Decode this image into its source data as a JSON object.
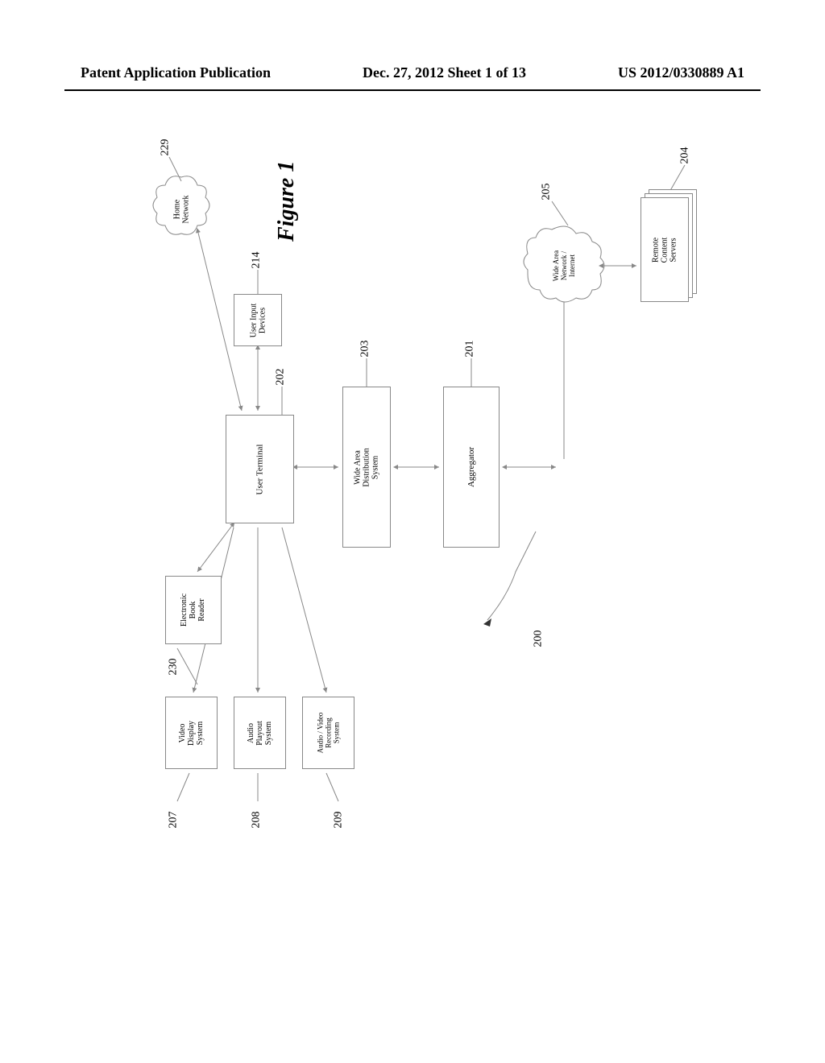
{
  "header": {
    "left": "Patent Application Publication",
    "center": "Dec. 27, 2012  Sheet 1 of 13",
    "right": "US 2012/0330889 A1"
  },
  "figure_title": "Figure 1",
  "boxes": {
    "user_input": "User Input\nDevices",
    "user_terminal": "User Terminal",
    "ebook_reader": "Electronic\nBook\nReader",
    "video_display": "Video\nDisplay\nSystem",
    "audio_playout": "Audio\nPlayout\nSystem",
    "av_recording": "Audio / Video\nRecording\nSystem",
    "wads": "Wide Area\nDistribution System",
    "aggregator": "Aggregator",
    "remote_servers": "Remote\nContent\nServers"
  },
  "clouds": {
    "home_network": "Home\nNetwork",
    "wan": "Wide Area\nNetwork /\nInternet"
  },
  "refs": {
    "r214": "214",
    "r229": "229",
    "r202": "202",
    "r203": "203",
    "r201": "201",
    "r205": "205",
    "r204": "204",
    "r230": "230",
    "r207": "207",
    "r208": "208",
    "r209": "209",
    "r200": "200"
  }
}
